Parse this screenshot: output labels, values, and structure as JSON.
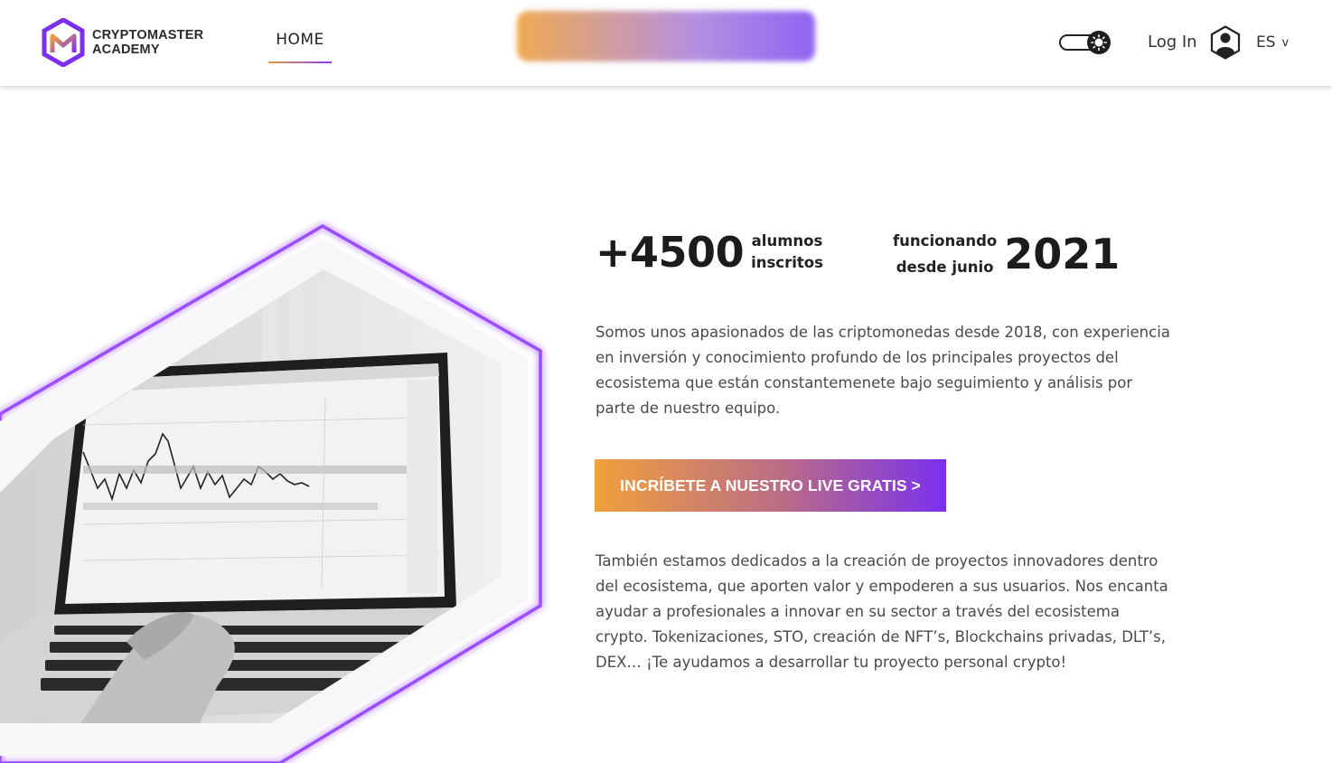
{
  "header": {
    "logo_line1": "CRYPTOMASTER",
    "logo_line2": "ACADEMY",
    "nav_home": "HOME",
    "login": "Log In",
    "language": "ES",
    "language_chevron": "v",
    "icons": [
      "logo-hexagon-icon",
      "sun-icon",
      "user-icon"
    ]
  },
  "stats": {
    "students_value": "+4500",
    "students_label_1": "alumnos",
    "students_label_2": "inscritos",
    "since_label_1": "funcionando",
    "since_label_2": "desde junio",
    "since_value": "2021"
  },
  "main": {
    "intro": "Somos unos apasionados de las criptomonedas desde 2018, con experiencia en inversión y conocimiento profundo de los principales proyectos del ecosistema que están constantemenete bajo seguimiento y análisis por parte de nuestro equipo.",
    "cta_label": "INCRÍBETE A NUESTRO LIVE GRATIS >",
    "outro": "También estamos dedicados a la creación de proyectos innovadores dentro del ecosistema, que aporten valor y empoderen a sus usuarios. Nos encanta ayudar a profesionales a innovar en su sector a través del ecosistema crypto. Tokenizaciones, STO, creación de NFT’s, Blockchains privadas, DLT’s, DEX… ¡Te ayudamos a desarrollar tu proyecto personal crypto!"
  },
  "colors": {
    "accent_orange": "#f0a03c",
    "accent_purple": "#7a30ee",
    "glow_purple": "#9b4dff"
  }
}
